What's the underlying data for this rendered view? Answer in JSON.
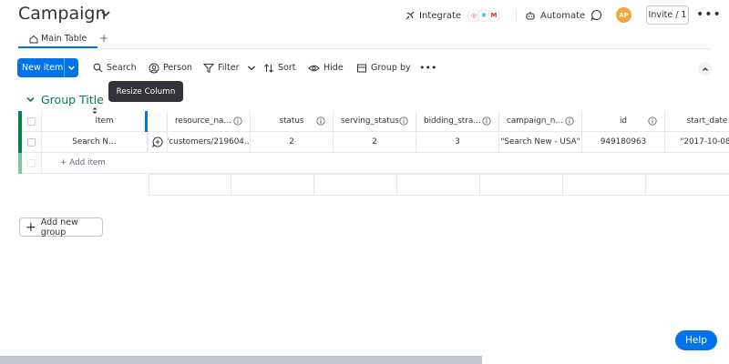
{
  "header": {
    "title": "Campaign",
    "integrate_label": "Integrate",
    "automate_label": "Automate",
    "avatar_initials": "AP",
    "invite_label": "Invite / 1",
    "more_label": "•••"
  },
  "tabs": [
    {
      "label": "Main Table"
    }
  ],
  "tab_add_label": "+",
  "toolbar": {
    "new_item_label": "New item",
    "search_label": "Search",
    "person_label": "Person",
    "filter_label": "Filter",
    "sort_label": "Sort",
    "hide_label": "Hide",
    "group_by_label": "Group by",
    "more_label": "•••"
  },
  "tooltip": {
    "text": "Resize Column"
  },
  "group": {
    "title": "Group Title",
    "color": "#00854d"
  },
  "table": {
    "item_header": "Item",
    "columns": [
      "resource_na…",
      "status",
      "serving_status",
      "bidding_stra…",
      "campaign_n…",
      "id",
      "start_date"
    ],
    "rows": [
      {
        "item": "Search N…",
        "values": [
          "\"customers/219604…",
          "2",
          "2",
          "3",
          "\"Search New - USA\"",
          "949180963",
          "\"2017-10-08\""
        ]
      }
    ],
    "add_item_label": "+ Add item"
  },
  "add_group_label": "Add new group",
  "help_label": "Help",
  "colors": {
    "accent": "#0073ea",
    "group_green": "#037f4c",
    "text": "#323338"
  }
}
